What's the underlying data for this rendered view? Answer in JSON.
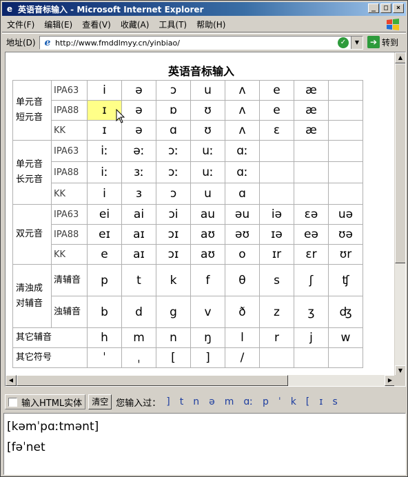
{
  "window": {
    "title": "英语音标输入 - Microsoft Internet Explorer",
    "min_btn": "_",
    "max_btn": "□",
    "close_btn": "×"
  },
  "menu": [
    "文件(F)",
    "编辑(E)",
    "查看(V)",
    "收藏(A)",
    "工具(T)",
    "帮助(H)"
  ],
  "address": {
    "label": "地址(D)",
    "url": "http://www.fmddlmyy.cn/yinbiao/",
    "go_label": "转到"
  },
  "page": {
    "title": "英语音标输入"
  },
  "table": {
    "monophthong_short": {
      "group": "单元音\n短元音",
      "rows": [
        {
          "label": "IPA63",
          "cells": [
            "i",
            "ə",
            "ɔ",
            "u",
            "ʌ",
            "e",
            "æ",
            ""
          ]
        },
        {
          "label": "IPA88",
          "cells": [
            "ɪ",
            "ə",
            "ɒ",
            "ʊ",
            "ʌ",
            "e",
            "æ",
            ""
          ]
        },
        {
          "label": "KK",
          "cells": [
            "ɪ",
            "ə",
            "ɑ",
            "ʊ",
            "ʌ",
            "ɛ",
            "æ",
            ""
          ]
        }
      ]
    },
    "monophthong_long": {
      "group": "单元音\n长元音",
      "rows": [
        {
          "label": "IPA63",
          "cells": [
            "iː",
            "əː",
            "ɔː",
            "uː",
            "ɑː",
            "",
            "",
            ""
          ]
        },
        {
          "label": "IPA88",
          "cells": [
            "iː",
            "ɜː",
            "ɔː",
            "uː",
            "ɑː",
            "",
            "",
            ""
          ]
        },
        {
          "label": "KK",
          "cells": [
            "i",
            "ɜ",
            "ɔ",
            "u",
            "ɑ",
            "",
            "",
            ""
          ]
        }
      ]
    },
    "diphthong": {
      "group": "双元音",
      "rows": [
        {
          "label": "IPA63",
          "cells": [
            "ei",
            "ai",
            "ɔi",
            "au",
            "əu",
            "iə",
            "εə",
            "uə"
          ]
        },
        {
          "label": "IPA88",
          "cells": [
            "eɪ",
            "aɪ",
            "ɔɪ",
            "aʊ",
            "əʊ",
            "ɪə",
            "eə",
            "ʊə"
          ]
        },
        {
          "label": "KK",
          "cells": [
            "e",
            "aɪ",
            "ɔɪ",
            "aʊ",
            "o",
            "ɪr",
            "ɛr",
            "ʊr"
          ]
        }
      ]
    },
    "paired_consonants": {
      "group": "清浊成对辅音",
      "rows": [
        {
          "label": "清辅音",
          "cells": [
            "p",
            "t",
            "k",
            "f",
            "θ",
            "s",
            "ʃ",
            "ʧ"
          ]
        },
        {
          "label": "浊辅音",
          "cells": [
            "b",
            "d",
            "g",
            "v",
            "ð",
            "z",
            "ʒ",
            "ʤ"
          ]
        }
      ]
    },
    "other_consonants": {
      "group": "其它辅音",
      "cells": [
        "h",
        "m",
        "n",
        "ŋ",
        "l",
        "r",
        "j",
        "w"
      ]
    },
    "other_symbols": {
      "group": "其它符号",
      "cells": [
        "ˈ",
        "ˌ",
        "[",
        "]",
        "/",
        "",
        "",
        ""
      ]
    }
  },
  "inputbar": {
    "checkbox_label": "输入HTML实体",
    "clear_label": "清空",
    "history_label": "您输入过：",
    "history": [
      "]",
      "t",
      "n",
      "ə",
      "m",
      "ɑː",
      "p",
      "ˈ",
      "k",
      "[",
      "ɪ",
      "s"
    ]
  },
  "output": {
    "lines": [
      "[kəmˈpɑːtmənt]",
      "[fəˈnet"
    ]
  },
  "colors": {
    "highlight": "#ffff88",
    "title_bar": "#0a246a",
    "history_text": "#1f3fa0"
  }
}
